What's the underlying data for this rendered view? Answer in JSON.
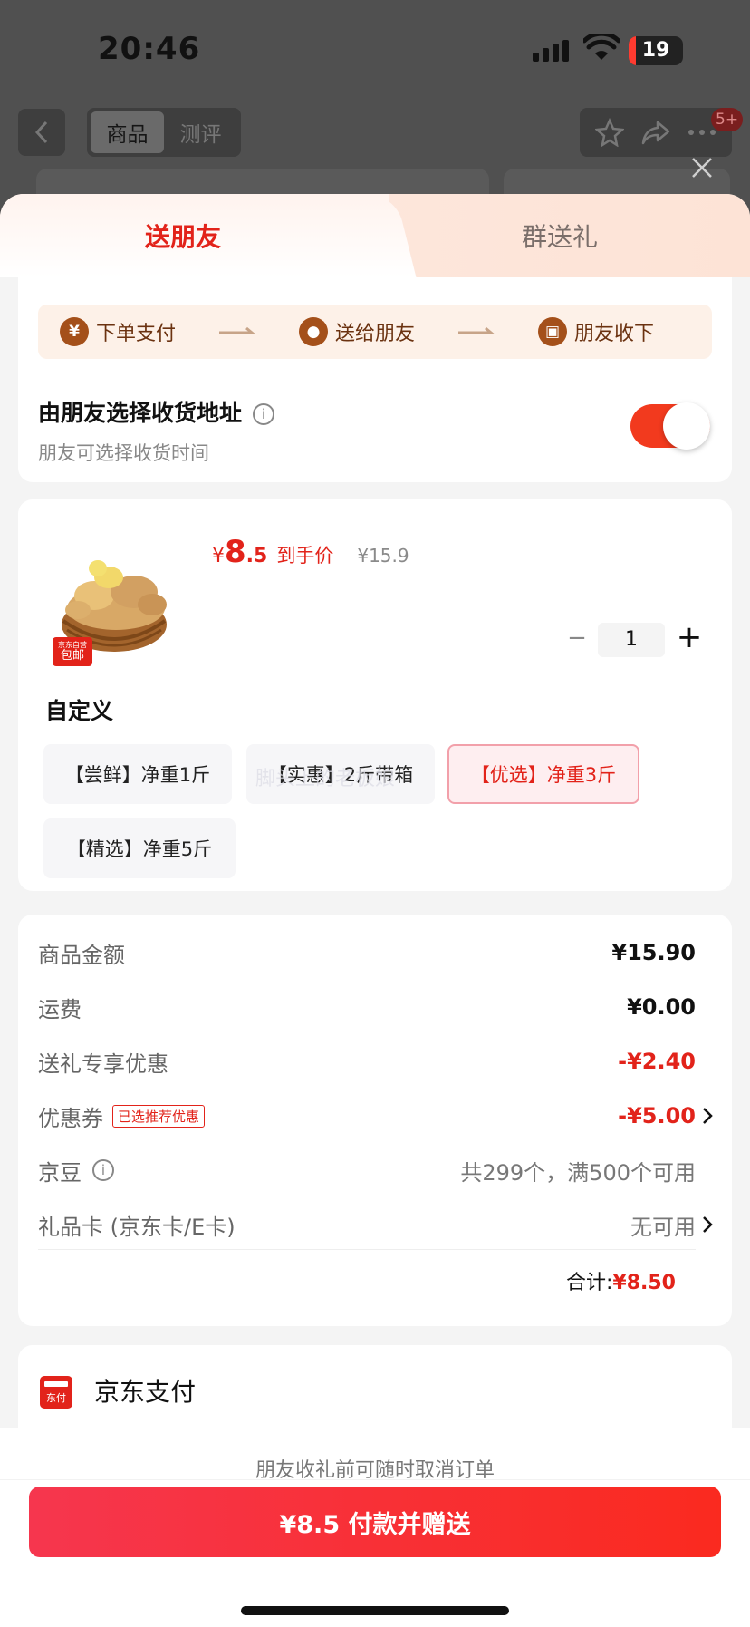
{
  "status_bar": {
    "time": "20:46",
    "battery": "19"
  },
  "top_nav": {
    "segments": [
      "商品",
      "测评"
    ],
    "badge": "5+"
  },
  "tabs": {
    "active": "送朋友",
    "inactive": "群送礼"
  },
  "flow": {
    "step1": "下单支付",
    "step2": "送给朋友",
    "step3": "朋友收下"
  },
  "address": {
    "title": "由朋友选择收货地址",
    "subtitle": "朋友可选择收货时间",
    "toggle_on": true
  },
  "product": {
    "price_yen": "¥",
    "price_int": "8",
    "price_dec": ".5",
    "price_label": "到手价",
    "original_price": "¥15.9",
    "tag_top": "京东自营",
    "tag_bottom": "包邮",
    "quantity": "1",
    "spec_title": "自定义",
    "specs": [
      "【尝鲜】净重1斤",
      "【实惠】2斤带箱",
      "【优选】净重3斤",
      "【精选】净重5斤"
    ],
    "selected_spec": "【优选】净重3斤",
    "watermark": "脚头上的老板娘"
  },
  "breakdown": {
    "goods_label": "商品金额",
    "goods_value": "¥15.90",
    "shipping_label": "运费",
    "shipping_value": "¥0.00",
    "gift_label": "送礼专享优惠",
    "gift_value": "-¥2.40",
    "coupon_label": "优惠券",
    "coupon_badge": "已选推荐优惠",
    "coupon_value": "-¥5.00",
    "beans_label": "京豆",
    "beans_value": "共299个，满500个可用",
    "card_label": "礼品卡 (京东卡/E卡)",
    "card_value": "无可用",
    "total_label": "合计:",
    "total_value": "¥8.50"
  },
  "payment": {
    "icon_text": "东付",
    "name": "京东支付"
  },
  "bottom": {
    "tip": "朋友收礼前可随时取消订单",
    "button": "¥8.5 付款并赠送"
  },
  "colors": {
    "accent": "#e2231a",
    "toggle": "#f23a1e",
    "flow_icon": "#a4501a"
  }
}
